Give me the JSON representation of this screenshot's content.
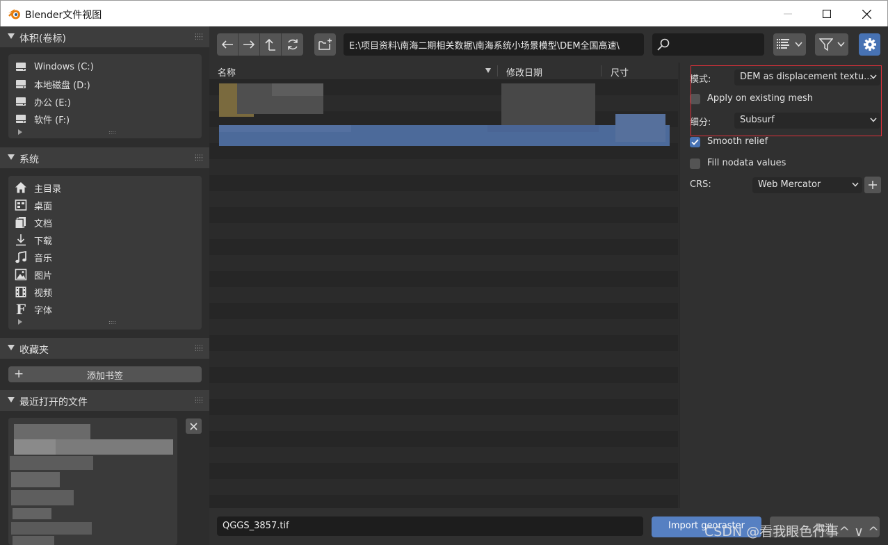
{
  "window": {
    "title": "Blender文件视图"
  },
  "colors": {
    "accent": "#4772b3",
    "button": "#545454",
    "field": "#1d1d1d",
    "highlight_box": "#e0303a"
  },
  "sidebar": {
    "volumes": {
      "title": "体积(卷标)",
      "items": [
        {
          "label": "Windows (C:)",
          "icon": "drive-icon"
        },
        {
          "label": "本地磁盘 (D:)",
          "icon": "drive-icon"
        },
        {
          "label": "办公 (E:)",
          "icon": "drive-icon"
        },
        {
          "label": "软件 (F:)",
          "icon": "drive-icon"
        }
      ]
    },
    "system": {
      "title": "系统",
      "items": [
        {
          "label": "主目录",
          "icon": "home-icon"
        },
        {
          "label": "桌面",
          "icon": "desktop-icon"
        },
        {
          "label": "文档",
          "icon": "documents-icon"
        },
        {
          "label": "下载",
          "icon": "download-icon"
        },
        {
          "label": "音乐",
          "icon": "music-icon"
        },
        {
          "label": "图片",
          "icon": "image-icon"
        },
        {
          "label": "视频",
          "icon": "video-icon"
        },
        {
          "label": "字体",
          "icon": "font-icon"
        }
      ]
    },
    "bookmarks": {
      "title": "收藏夹",
      "add_label": "添加书签"
    },
    "recent": {
      "title": "最近打开的文件"
    }
  },
  "toolbar": {
    "path": "E:\\项目资料\\南海二期相关数据\\南海系统小场景模型\\DEM全国高速\\"
  },
  "file_list": {
    "columns": [
      "名称",
      "修改日期",
      "尺寸"
    ]
  },
  "options": {
    "mode_label": "模式:",
    "mode_value": "DEM as displacement textu...",
    "apply_existing_label": "Apply on existing mesh",
    "apply_existing_checked": false,
    "subdivision_label": "细分:",
    "subdivision_value": "Subsurf",
    "smooth_relief_label": "Smooth relief",
    "smooth_relief_checked": true,
    "fill_nodata_label": "Fill nodata values",
    "fill_nodata_checked": false,
    "crs_label": "CRS:",
    "crs_value": "Web Mercator"
  },
  "bottom": {
    "filename": "QGGS_3857.tif",
    "import_label": "Import georaster",
    "cancel_label": "取消"
  },
  "watermark": "CSDN @看我眼色行事^ ∨ ^"
}
